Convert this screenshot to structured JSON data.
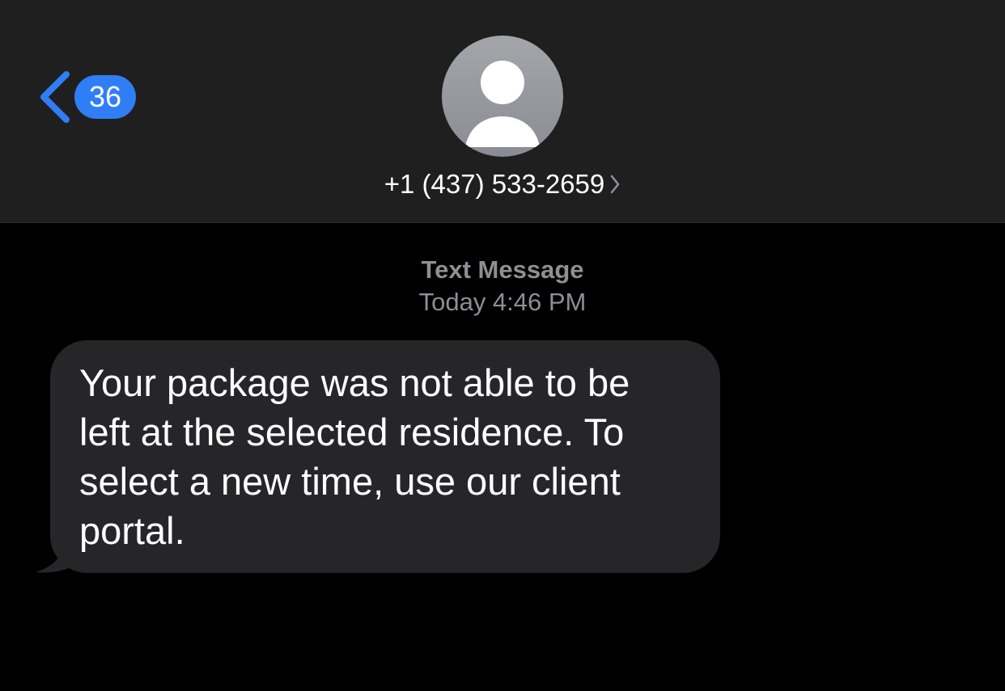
{
  "header": {
    "back_badge_count": "36",
    "contact_number": "+1 (437) 533-2659"
  },
  "conversation": {
    "service_label": "Text Message",
    "timestamp": "Today 4:46 PM",
    "messages": [
      {
        "direction": "incoming",
        "text": "Your package was not able to be left at the selected residence. To select a new time, use our client portal."
      }
    ]
  },
  "colors": {
    "accent": "#2f7ef6",
    "header_bg": "#1f1f1f",
    "bubble_bg": "#262629",
    "secondary_text": "#8e8e93"
  },
  "icons": {
    "back": "chevron-left-icon",
    "avatar": "person-icon",
    "disclosure": "chevron-right-icon"
  }
}
